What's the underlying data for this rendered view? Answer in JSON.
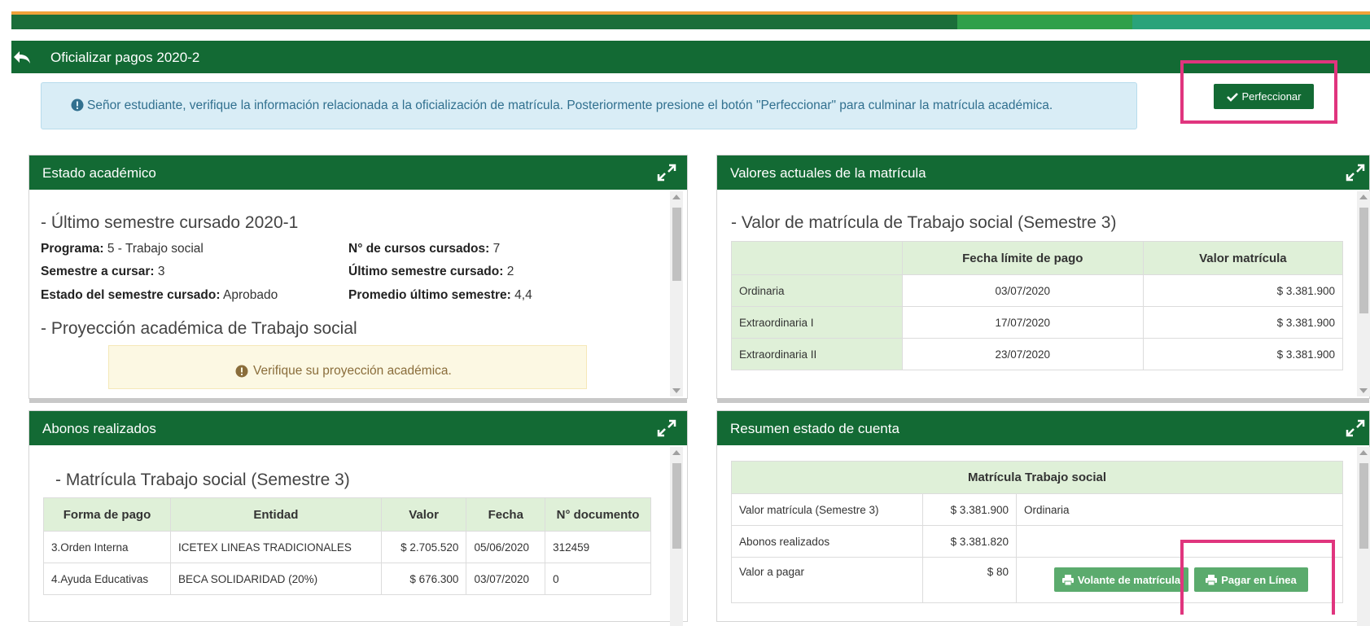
{
  "header": {
    "title": "Oficializar pagos 2020-2"
  },
  "alert": {
    "text": "Señor estudiante, verifique la información relacionada a la oficialización de matrícula. Posteriormente presione el botón \"Perfeccionar\" para culminar la matrícula académica."
  },
  "perfeccionar_button": "Perfeccionar",
  "estado": {
    "title": "Estado académico",
    "last_semester_heading": "- Último semestre cursado 2020-1",
    "programa_label": "Programa:",
    "programa_value": "5 - Trabajo social",
    "semestre_label": "Semestre a cursar:",
    "semestre_value": "3",
    "estado_label": "Estado del semestre cursado:",
    "estado_value": "Aprobado",
    "cursos_label": "N° de cursos cursados:",
    "cursos_value": "7",
    "ultimo_label": "Último semestre cursado:",
    "ultimo_value": "2",
    "promedio_label": "Promedio último semestre:",
    "promedio_value": "4,4",
    "proyeccion_heading": "- Proyección académica de Trabajo social",
    "warning": "Verifique su proyección académica."
  },
  "valores": {
    "title": "Valores actuales de la matrícula",
    "heading": "- Valor de matrícula de Trabajo social (Semestre 3)",
    "columns": [
      "",
      "Fecha límite de pago",
      "Valor matrícula"
    ],
    "rows": [
      [
        "Ordinaria",
        "03/07/2020",
        "$ 3.381.900"
      ],
      [
        "Extraordinaria I",
        "17/07/2020",
        "$ 3.381.900"
      ],
      [
        "Extraordinaria II",
        "23/07/2020",
        "$ 3.381.900"
      ]
    ]
  },
  "abonos": {
    "title": "Abonos realizados",
    "heading": "- Matrícula Trabajo social (Semestre 3)",
    "columns": [
      "Forma de pago",
      "Entidad",
      "Valor",
      "Fecha",
      "N° documento"
    ],
    "rows": [
      [
        "3.Orden Interna",
        "ICETEX LINEAS TRADICIONALES",
        "$ 2.705.520",
        "05/06/2020",
        "312459"
      ],
      [
        "4.Ayuda Educativas",
        "BECA SOLIDARIDAD (20%)",
        "$ 676.300",
        "03/07/2020",
        "0"
      ]
    ]
  },
  "resumen": {
    "title": "Resumen estado de cuenta",
    "table_header": "Matrícula Trabajo social",
    "rows": [
      [
        "Valor matrícula (Semestre 3)",
        "$ 3.381.900",
        "Ordinaria"
      ],
      [
        "Abonos realizados",
        "$ 3.381.820",
        ""
      ],
      [
        "Valor a pagar",
        "$ 80",
        ""
      ]
    ],
    "volante_button": "Volante de matrícula",
    "pagar_button": "Pagar en Línea"
  },
  "colors": {
    "brand_green": "#136a34",
    "highlight": "#e0357e"
  }
}
